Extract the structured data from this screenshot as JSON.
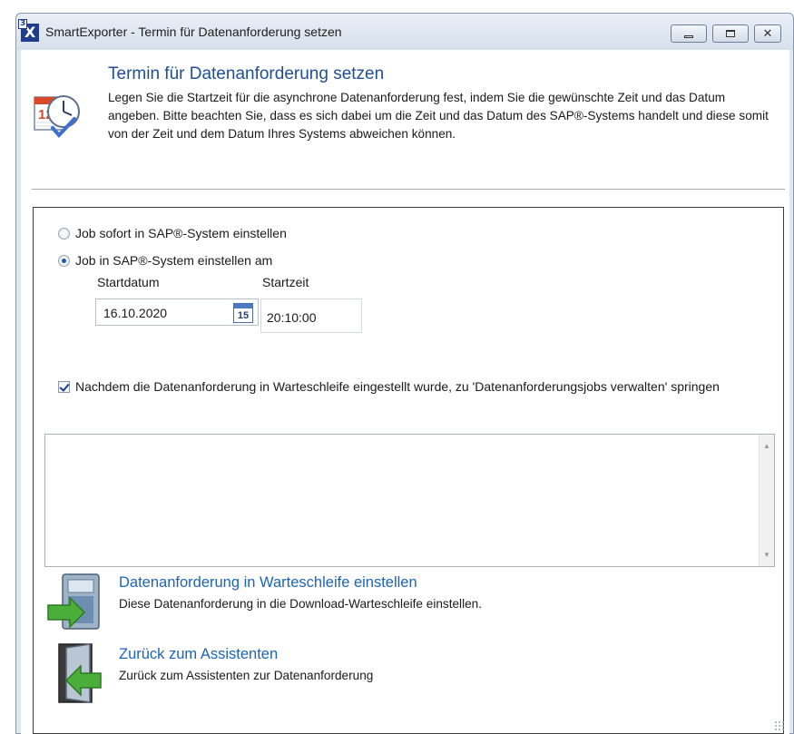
{
  "window": {
    "title": "SmartExporter - Termin für Datenanforderung setzen",
    "app_icon_label": "X",
    "app_icon_superscript": "3",
    "controls": [
      "minimize",
      "maximize",
      "close"
    ]
  },
  "header": {
    "title": "Termin für Datenanforderung setzen",
    "description": "Legen Sie die Startzeit für die asynchrone Datenanforderung fest, indem Sie die gewünschte Zeit und das Datum angeben. Bitte beachten Sie, dass es sich dabei um die Zeit und das Datum des SAP®-Systems handelt und diese somit von der Zeit und dem Datum Ihres Systems abweichen können.",
    "icon": "calendar-clock-icon",
    "calendar_icon_day": "12"
  },
  "options": {
    "radio_immediate": {
      "label": "Job sofort in SAP®-System einstellen",
      "checked": false
    },
    "radio_scheduled": {
      "label": "Job in SAP®-System einstellen am",
      "checked": true
    },
    "startdatum_label": "Startdatum",
    "startzeit_label": "Startzeit",
    "startdatum_value": "16.10.2020",
    "calendar_button_day": "15",
    "startzeit_value": "20:10:00",
    "jump_checkbox": {
      "label": "Nachdem die Datenanforderung in Warteschleife eingestellt wurde, zu 'Datenanforderungsjobs verwalten' springen",
      "checked": true
    }
  },
  "memo": {
    "value": ""
  },
  "actions": [
    {
      "link": "Datenanforderung in Warteschleife einstellen",
      "description": "Diese Datenanforderung in die Download-Warteschleife einstellen.",
      "icon": "queue-server-icon"
    },
    {
      "link": "Zurück zum Assistenten",
      "description": "Zurück zum Assistenten zur Datenanforderung",
      "icon": "back-door-icon"
    }
  ]
}
